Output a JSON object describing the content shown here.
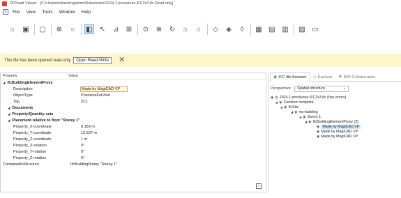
{
  "window": {
    "title": "DDScad Viewer - [C:\\Users\\mikaelengstrom\\Downloads\\2024.1 provisions IFC2x3.ifc Read only]"
  },
  "menu": {
    "items": [
      "File",
      "View",
      "Tools",
      "Window",
      "Help"
    ]
  },
  "notification": {
    "text": "This file has been opened read-only",
    "button_label": "Open Read-Write",
    "close_glyph": "✕"
  },
  "property_grid": {
    "header_property": "Property",
    "header_value": "Value",
    "root_group": "IfcBuildingElementProxy",
    "rows": [
      {
        "name": "Description",
        "value": "Made by MagiCAD VP"
      },
      {
        "name": "ObjectType",
        "value": "ProvisionForVoid"
      },
      {
        "name": "Tag",
        "value": "2C1"
      }
    ],
    "sub_groups": [
      "Documents",
      "Property/Quantity sets",
      "Placement relative to floor \"Storey 1\""
    ],
    "placement_rows": [
      {
        "name": "Property_X-coordinate",
        "value": "8.189 m"
      },
      {
        "name": "Property_Y-coordinate",
        "value": "12.507 m"
      },
      {
        "name": "Property_Z-coordinate",
        "value": "1 m"
      },
      {
        "name": "Property_X-rotation",
        "value": "0°"
      },
      {
        "name": "Property_Y-rotation",
        "value": "0°"
      },
      {
        "name": "Property_Z-rotation",
        "value": "0°"
      }
    ],
    "contained": {
      "name": "ContainedInStructure",
      "value": "IfcBuildingStorey \"Storey 1\""
    }
  },
  "browser": {
    "tabs": [
      "IFC file browser",
      "Explorer",
      "BIM Collaboration"
    ],
    "perspective_label": "Perspective:",
    "perspective_value": "Spatial structure",
    "tree": [
      {
        "label": "2024.1 provisions IFC2x3.ifc (has errors)"
      },
      {
        "label": "Common template"
      },
      {
        "label": "IfcSite"
      },
      {
        "label": "mc-building"
      },
      {
        "label": "Storey 1"
      },
      {
        "label": "IfcBuildingElementProxy (3)"
      },
      {
        "label": "Made by MagiCAD VP"
      },
      {
        "label": "Made by MagiCAD VP"
      },
      {
        "label": "Made by MagiCAD VP"
      }
    ]
  },
  "icons": {
    "app": "ddscad-app-icon",
    "accent": "#e8a33d",
    "selection": "#cde6fb",
    "notify_bg": "#fff6c9"
  }
}
